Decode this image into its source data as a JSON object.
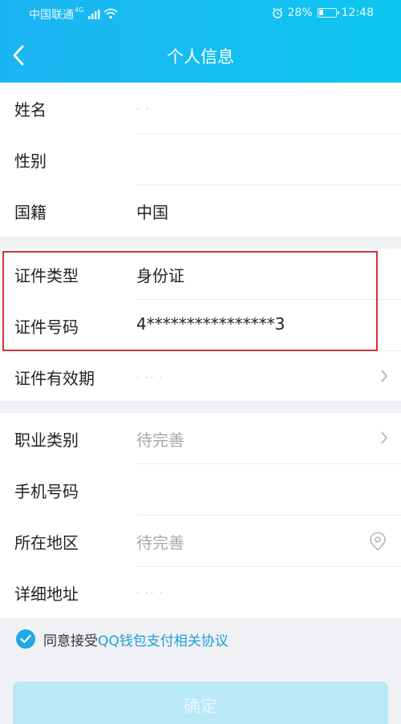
{
  "status_bar": {
    "carrier": "中国联通",
    "network_badge": "4G",
    "battery": "28%",
    "battery_level": 0.28,
    "time": "12:48"
  },
  "header": {
    "title": "个人信息"
  },
  "sections": [
    {
      "rows": [
        {
          "label": "姓名",
          "value": "·  ·"
        },
        {
          "label": "性别",
          "value": ""
        },
        {
          "label": "国籍",
          "value": "中国"
        }
      ]
    },
    {
      "rows": [
        {
          "label": "证件类型",
          "value": "身份证"
        },
        {
          "label": "证件号码",
          "value": "4****************3"
        },
        {
          "label": "证件有效期",
          "value": "·  ··  ·"
        }
      ]
    },
    {
      "rows": [
        {
          "label": "职业类别",
          "value": "待完善"
        },
        {
          "label": "手机号码",
          "value": ""
        },
        {
          "label": "所在地区",
          "value": "待完善"
        },
        {
          "label": "详细地址",
          "value": "·  ··  ·"
        }
      ]
    }
  ],
  "agreement": {
    "prefix": "同意接受",
    "link": "QQ钱包支付相关协议",
    "checked": true
  },
  "confirm_button": {
    "label": "确定"
  },
  "colors": {
    "header": "#1bb4f3",
    "accent": "#21a8e6",
    "highlight_border": "#c9343a"
  }
}
